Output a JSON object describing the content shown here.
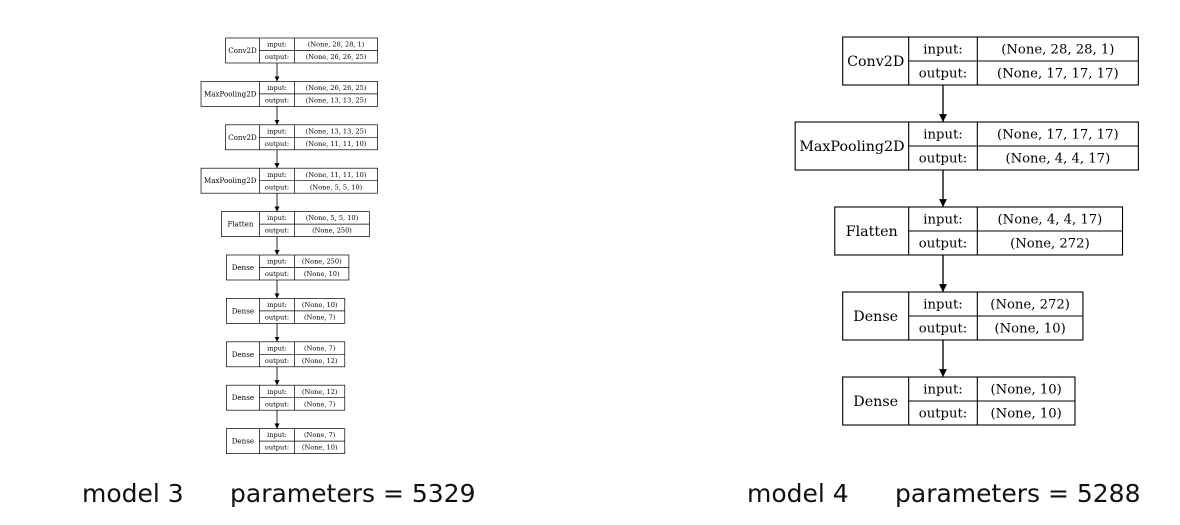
{
  "models": [
    {
      "caption_name": "model 3",
      "caption_params": "parameters = 5329",
      "layers": [
        {
          "type": "Conv2D",
          "input_label": "input:",
          "input": "(None, 28, 28, 1)",
          "output_label": "output:",
          "output": "(None, 26, 26, 25)"
        },
        {
          "type": "MaxPooling2D",
          "input_label": "input:",
          "input": "(None, 26, 26, 25)",
          "output_label": "output:",
          "output": "(None, 13, 13, 25)"
        },
        {
          "type": "Conv2D",
          "input_label": "input:",
          "input": "(None, 13, 13, 25)",
          "output_label": "output:",
          "output": "(None, 11, 11, 10)"
        },
        {
          "type": "MaxPooling2D",
          "input_label": "input:",
          "input": "(None, 11, 11, 10)",
          "output_label": "output:",
          "output": "(None, 5, 5, 10)"
        },
        {
          "type": "Flatten",
          "input_label": "input:",
          "input": "(None, 5, 5, 10)",
          "output_label": "output:",
          "output": "(None, 250)"
        },
        {
          "type": "Dense",
          "input_label": "input:",
          "input": "(None, 250)",
          "output_label": "output:",
          "output": "(None, 10)"
        },
        {
          "type": "Dense",
          "input_label": "input:",
          "input": "(None, 10)",
          "output_label": "output:",
          "output": "(None, 7)"
        },
        {
          "type": "Dense",
          "input_label": "input:",
          "input": "(None, 7)",
          "output_label": "output:",
          "output": "(None, 12)"
        },
        {
          "type": "Dense",
          "input_label": "input:",
          "input": "(None, 12)",
          "output_label": "output:",
          "output": "(None, 7)"
        },
        {
          "type": "Dense",
          "input_label": "input:",
          "input": "(None, 7)",
          "output_label": "output:",
          "output": "(None, 10)"
        }
      ]
    },
    {
      "caption_name": "model 4",
      "caption_params": "parameters = 5288",
      "layers": [
        {
          "type": "Conv2D",
          "input_label": "input:",
          "input": "(None, 28, 28, 1)",
          "output_label": "output:",
          "output": "(None, 17, 17, 17)"
        },
        {
          "type": "MaxPooling2D",
          "input_label": "input:",
          "input": "(None, 17, 17, 17)",
          "output_label": "output:",
          "output": "(None, 4, 4, 17)"
        },
        {
          "type": "Flatten",
          "input_label": "input:",
          "input": "(None, 4, 4, 17)",
          "output_label": "output:",
          "output": "(None, 272)"
        },
        {
          "type": "Dense",
          "input_label": "input:",
          "input": "(None, 272)",
          "output_label": "output:",
          "output": "(None, 10)"
        },
        {
          "type": "Dense",
          "input_label": "input:",
          "input": "(None, 10)",
          "output_label": "output:",
          "output": "(None, 10)"
        }
      ]
    }
  ]
}
